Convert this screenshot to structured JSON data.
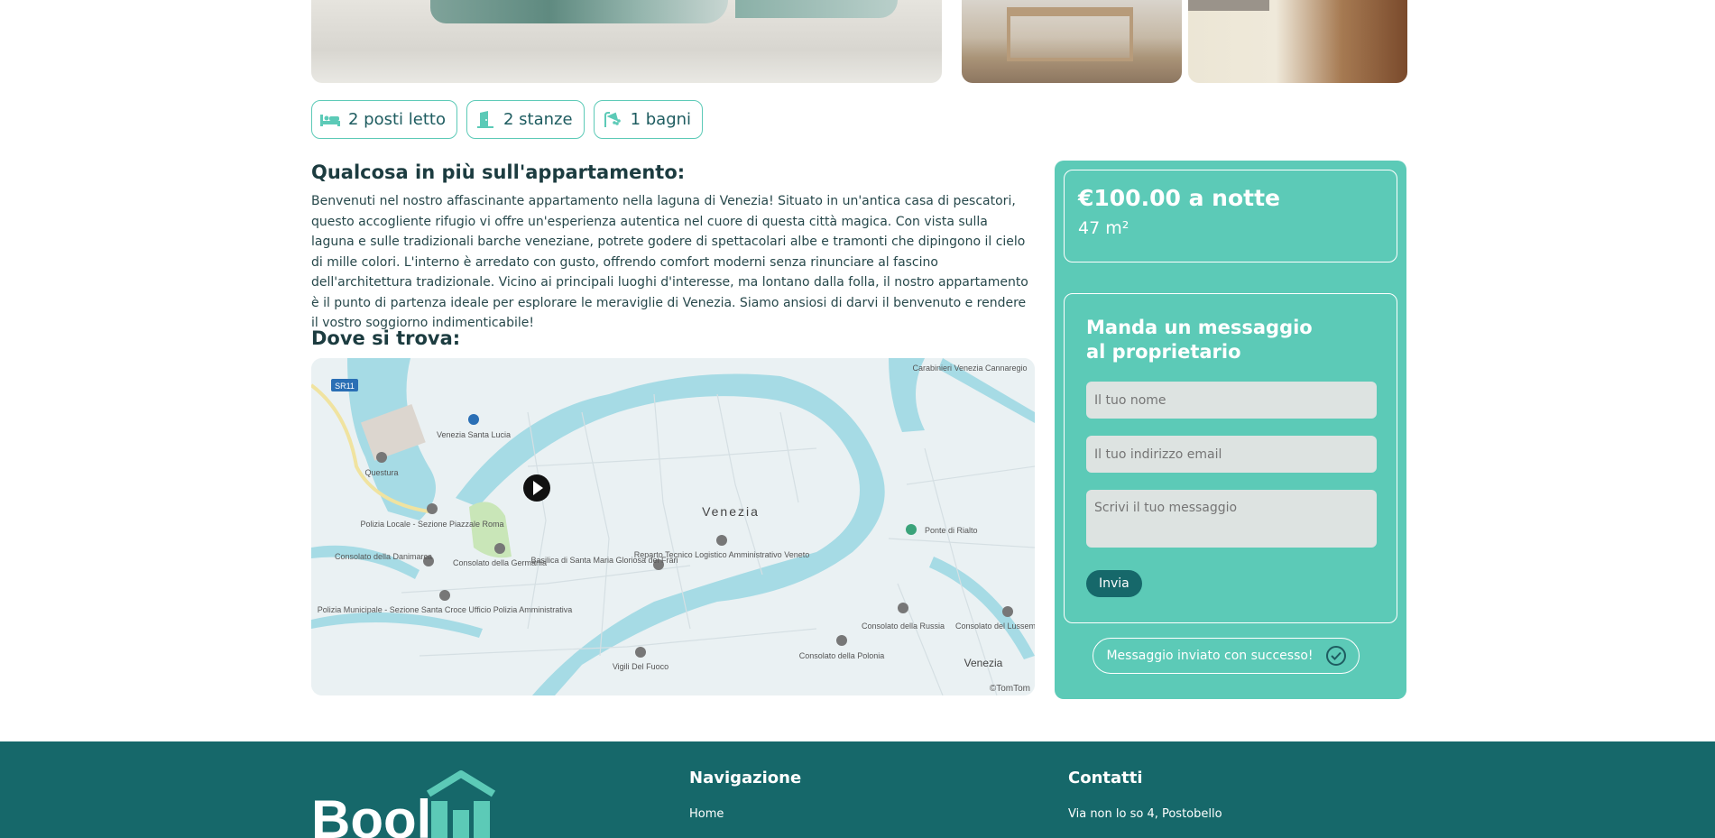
{
  "features": [
    {
      "icon": "bed-icon",
      "label": "2 posti letto"
    },
    {
      "icon": "door-icon",
      "label": "2 stanze"
    },
    {
      "icon": "shower-icon",
      "label": "1 bagni"
    }
  ],
  "description": {
    "title": "Qualcosa in più sull'appartamento:",
    "text": "Benvenuti nel nostro affascinante appartamento nella laguna di Venezia! Situato in un'antica casa di pescatori, questo accogliente rifugio vi offre un'esperienza autentica nel cuore di questa città magica. Con vista sulla laguna e sulle tradizionali barche veneziane, potrete godere di spettacolari albe e tramonti che dipingono il cielo di mille colori. L'interno è arredato con gusto, offrendo comfort moderni senza rinunciare al fascino dell'architettura tradizionale. Vicino ai principali luoghi d'interesse, ma lontano dalla folla, il nostro appartamento è il punto di partenza ideale per esplorare le meraviglie di Venezia. Siamo ansiosi di darvi il benvenuto e rendere il vostro soggiorno indimenticabile!"
  },
  "location": {
    "title": "Dove si trova:",
    "map_labels": {
      "road": "SR11",
      "station": "Venezia Santa Lucia",
      "questura": "Questura",
      "polizia": "Polizia Locale - Sezione Piazzale Roma",
      "danimarca": "Consolato della Danimarca",
      "germania": "Consolato della Germania",
      "municipale": "Polizia Municipale - Sezione Santa Croce Ufficio Polizia Amministrativa",
      "city": "Venezia",
      "frari": "Basilica di Santa Maria Gloriosa dei Frari",
      "reparto": "Reparto Tecnico Logistico Amministrativo Veneto",
      "vigili": "Vigili Del Fuoco",
      "carabinieri": "Carabinieri Venezia Cannaregio",
      "rialto": "Ponte di Rialto",
      "russia": "Consolato della Russia",
      "polonia": "Consolato della Polonia",
      "lussemburgo": "Consolato del Lussemburgo",
      "venezia2": "Venezia",
      "copyright": "©TomTom"
    }
  },
  "pricing": {
    "price": "€100.00 a notte",
    "area": "47 m²"
  },
  "contact_form": {
    "title": "Manda un messaggio al proprietario",
    "name_placeholder": "Il tuo nome",
    "email_placeholder": "Il tuo indirizzo email",
    "message_placeholder": "Scrivi il tuo messaggio",
    "submit_label": "Invia",
    "success_message": "Messaggio inviato con successo!"
  },
  "footer": {
    "logo_text": "Bool",
    "nav_title": "Navigazione",
    "nav_home": "Home",
    "contacts_title": "Contatti",
    "address": "Via non lo so 4, Postobello"
  },
  "colors": {
    "accent": "#5ccab7",
    "dark": "#16686a",
    "water": "#a6dbe5"
  }
}
